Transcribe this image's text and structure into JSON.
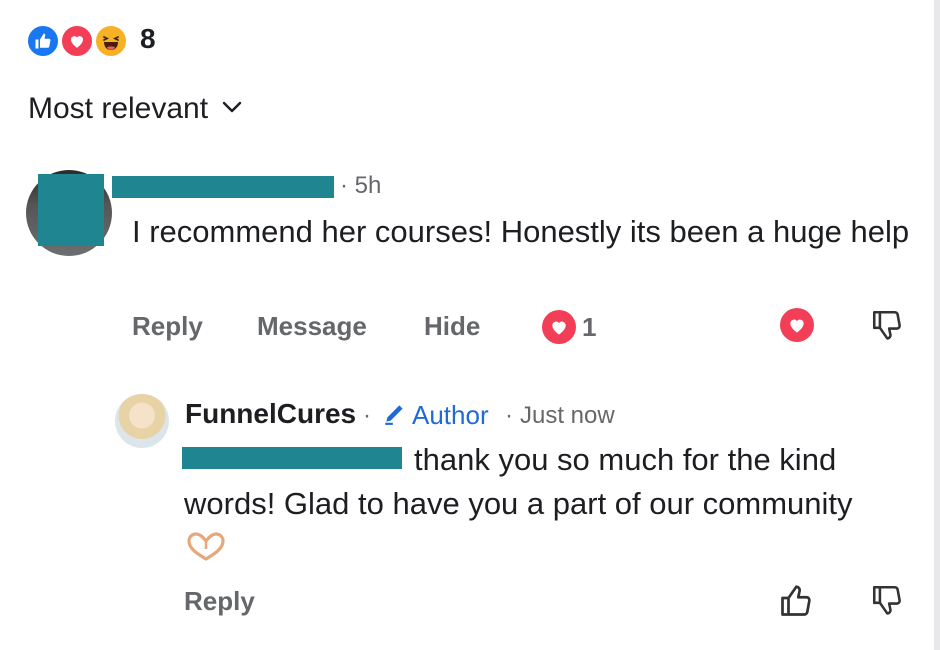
{
  "reactions": {
    "types": [
      "like-icon",
      "love-icon",
      "haha-icon"
    ],
    "count": "8"
  },
  "sort": {
    "label": "Most relevant"
  },
  "comment1": {
    "time": "· 5h",
    "text": "I recommend her courses! Honestly its been a huge help",
    "actions": {
      "reply": "Reply",
      "message": "Message",
      "hide": "Hide"
    },
    "reaction_count": "1"
  },
  "reply": {
    "author": "FunnelCures",
    "badge": "Author",
    "time": "Just now",
    "text": "thank you so much for the kind words! Glad to have you a part of our community",
    "emoji": "🫶",
    "action_reply": "Reply"
  },
  "colors": {
    "like_blue": "#1877f2",
    "love_red": "#f33e58",
    "haha_yellow": "#f7b125",
    "author_blue": "#1f6ad6",
    "redaction": "#1f8591",
    "secondary_text": "#65676b"
  }
}
